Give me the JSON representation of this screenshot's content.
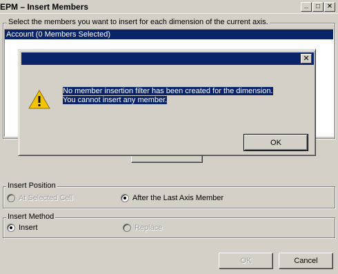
{
  "window": {
    "title": "EPM – Insert Members",
    "minimize_glyph": "_",
    "maximize_glyph": "□",
    "close_glyph": "✕"
  },
  "members_section": {
    "legend": "Select the members you want to insert for each dimension of the current axis.",
    "list_items": [
      "Account (0 Members Selected)"
    ]
  },
  "insert_position": {
    "legend": "Insert Position",
    "options": [
      {
        "label": "At Selected Cell",
        "checked": false,
        "enabled": false
      },
      {
        "label": "After the Last Axis Member",
        "checked": true,
        "enabled": true
      }
    ]
  },
  "insert_method": {
    "legend": "Insert Method",
    "options": [
      {
        "label": "Insert",
        "checked": true,
        "enabled": true
      },
      {
        "label": "Replace",
        "checked": false,
        "enabled": false
      }
    ]
  },
  "footer": {
    "ok_label": "OK",
    "cancel_label": "Cancel"
  },
  "message_box": {
    "title": "",
    "close_glyph": "✕",
    "icon": "warning-icon",
    "message": "No member insertion filter has been created for the dimension. You cannot insert any member.",
    "ok_label": "OK"
  },
  "colors": {
    "selection": "#0a246a",
    "face": "#d4d0c8",
    "warning": "#f5c400"
  }
}
